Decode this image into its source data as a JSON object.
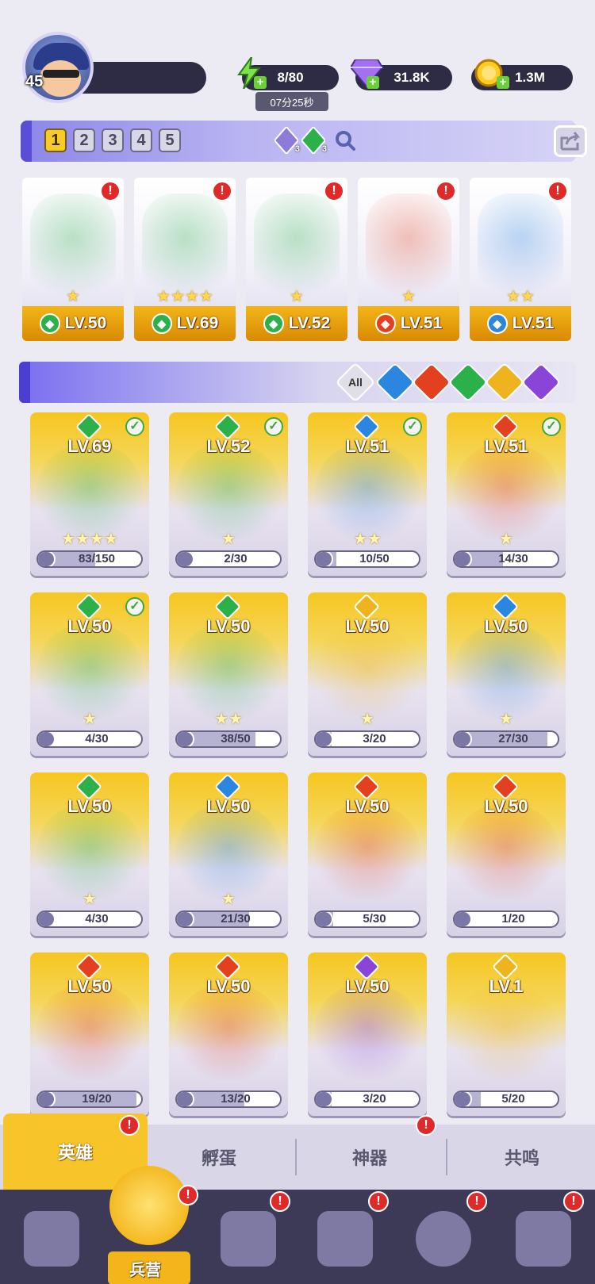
{
  "player": {
    "level": "45"
  },
  "resources": {
    "energy": {
      "value": "8/80",
      "timer": "07分25秒",
      "icon": "lightning-icon"
    },
    "gems": {
      "value": "31.8K",
      "icon": "purple-gem-icon"
    },
    "gold": {
      "value": "1.3M",
      "icon": "gold-coin-icon"
    }
  },
  "teams": {
    "numbers": [
      "1",
      "2",
      "3",
      "4",
      "5"
    ],
    "active": "1",
    "crystal_purple_count": "3",
    "crystal_green_count": "3"
  },
  "team_cards": [
    {
      "level": "LV.50",
      "element": "nature",
      "stars": "★"
    },
    {
      "level": "LV.69",
      "element": "nature",
      "stars": "★★★★"
    },
    {
      "level": "LV.52",
      "element": "nature",
      "stars": "★"
    },
    {
      "level": "LV.51",
      "element": "fire",
      "stars": "★"
    },
    {
      "level": "LV.51",
      "element": "water",
      "stars": "★★"
    }
  ],
  "filters": [
    {
      "label": "All",
      "element": "all"
    },
    {
      "label": "",
      "element": "water"
    },
    {
      "label": "",
      "element": "fire"
    },
    {
      "label": "",
      "element": "nature"
    },
    {
      "label": "",
      "element": "light"
    },
    {
      "label": "",
      "element": "dark"
    }
  ],
  "heroes": [
    {
      "level": "LV.69",
      "element": "nature",
      "progress": "83/150",
      "fill": 0.55,
      "in_team": true,
      "stars": "★★★★"
    },
    {
      "level": "LV.52",
      "element": "nature",
      "progress": "2/30",
      "fill": 0.07,
      "in_team": true,
      "stars": "★"
    },
    {
      "level": "LV.51",
      "element": "water",
      "progress": "10/50",
      "fill": 0.2,
      "in_team": true,
      "stars": "★★"
    },
    {
      "level": "LV.51",
      "element": "fire",
      "progress": "14/30",
      "fill": 0.47,
      "in_team": true,
      "stars": "★"
    },
    {
      "level": "LV.50",
      "element": "nature",
      "progress": "4/30",
      "fill": 0.13,
      "in_team": true,
      "stars": "★"
    },
    {
      "level": "LV.50",
      "element": "nature",
      "progress": "38/50",
      "fill": 0.76,
      "in_team": false,
      "stars": "★★"
    },
    {
      "level": "LV.50",
      "element": "light",
      "progress": "3/20",
      "fill": 0.15,
      "in_team": false,
      "stars": "★"
    },
    {
      "level": "LV.50",
      "element": "water",
      "progress": "27/30",
      "fill": 0.9,
      "in_team": false,
      "stars": "★"
    },
    {
      "level": "LV.50",
      "element": "nature",
      "progress": "4/30",
      "fill": 0.13,
      "in_team": false,
      "stars": "★"
    },
    {
      "level": "LV.50",
      "element": "water",
      "progress": "21/30",
      "fill": 0.7,
      "in_team": false,
      "stars": "★"
    },
    {
      "level": "LV.50",
      "element": "fire",
      "progress": "5/30",
      "fill": 0.17,
      "in_team": false,
      "stars": ""
    },
    {
      "level": "LV.50",
      "element": "fire",
      "progress": "1/20",
      "fill": 0.05,
      "in_team": false,
      "stars": ""
    },
    {
      "level": "LV.50",
      "element": "fire",
      "progress": "19/20",
      "fill": 0.95,
      "in_team": false,
      "stars": ""
    },
    {
      "level": "LV.50",
      "element": "fire",
      "progress": "13/20",
      "fill": 0.65,
      "in_team": false,
      "stars": ""
    },
    {
      "level": "LV.50",
      "element": "dark",
      "progress": "3/20",
      "fill": 0.15,
      "in_team": false,
      "stars": ""
    },
    {
      "level": "LV.1",
      "element": "light",
      "progress": "5/20",
      "fill": 0.25,
      "in_team": false,
      "stars": ""
    }
  ],
  "subtabs": {
    "heroes": "英雄",
    "hatch": "孵蛋",
    "artifacts": "神器",
    "resonance": "共鸣"
  },
  "bottom_nav": {
    "active_label": "兵营"
  },
  "colors": {
    "nature": "#2bb04a",
    "fire": "#e2401e",
    "water": "#2b86e0",
    "light": "#f0b320",
    "dark": "#8a45d8",
    "all": "#8e8aa8"
  }
}
